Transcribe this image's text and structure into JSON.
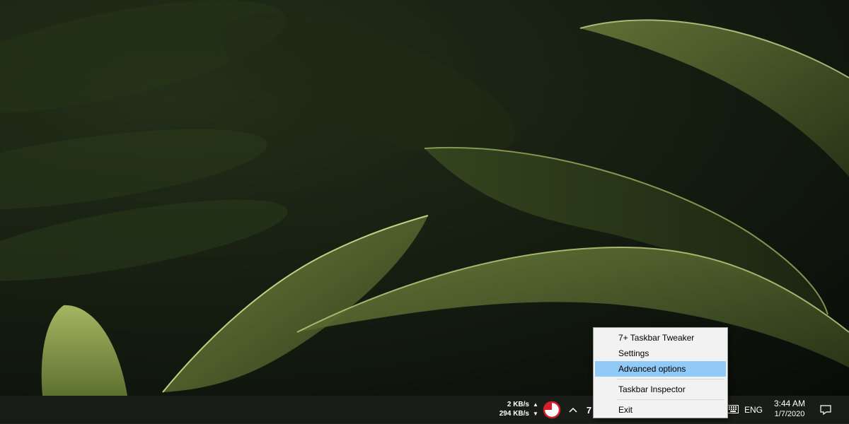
{
  "wallpaper": {
    "icon": "leaf-wallpaper"
  },
  "taskbar": {
    "net_speed": {
      "upload": "2 KB/s",
      "download": "294 KB/s",
      "upload_arrow": "▲",
      "download_arrow": "▼"
    },
    "tray": {
      "chevron": "^",
      "tweaker_glyph": "7"
    },
    "language": "ENG",
    "clock": {
      "time": "3:44 AM",
      "date": "1/7/2020"
    }
  },
  "context_menu": {
    "items": [
      {
        "label": "7+ Taskbar Tweaker"
      },
      {
        "label": "Settings"
      },
      {
        "label": "Advanced options"
      },
      {
        "label": "Taskbar Inspector"
      },
      {
        "label": "Exit"
      }
    ],
    "selected_item": "Advanced options"
  },
  "colors": {
    "taskbar": "#1a1c17",
    "menu_background": "#f2f2f2",
    "menu_highlight": "#91c9f7",
    "leaf_green": "#4b5e2c"
  }
}
